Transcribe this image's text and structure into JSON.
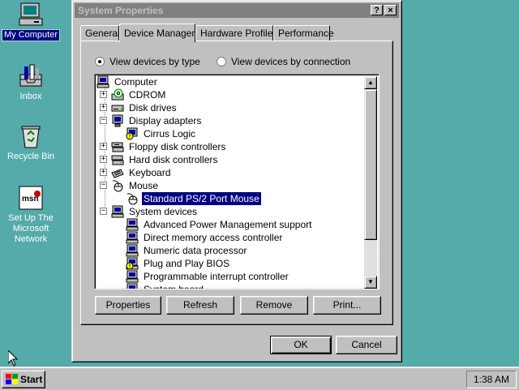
{
  "desktop": {
    "icons": [
      {
        "label": "My Computer",
        "icon": "my-computer-icon",
        "selected": true
      },
      {
        "label": "Inbox",
        "icon": "inbox-icon"
      },
      {
        "label": "Recycle Bin",
        "icon": "recycle-bin-icon"
      },
      {
        "label": "Set Up The Microsoft Network",
        "icon": "msn-icon"
      }
    ]
  },
  "dialog": {
    "title": "System Properties",
    "help_button": "?",
    "close_button": "×",
    "tabs": [
      {
        "label": "General"
      },
      {
        "label": "Device Manager",
        "active": true
      },
      {
        "label": "Hardware Profiles"
      },
      {
        "label": "Performance"
      }
    ],
    "view_options": {
      "by_type": "View devices by type",
      "by_connection": "View devices by connection",
      "selected": "by_type"
    },
    "tree": [
      {
        "label": "Computer",
        "level": 0,
        "icon": "computer-icon"
      },
      {
        "label": "CDROM",
        "level": 1,
        "expander": "+",
        "icon": "cdrom-icon"
      },
      {
        "label": "Disk drives",
        "level": 1,
        "expander": "+",
        "icon": "disk-drive-icon"
      },
      {
        "label": "Display adapters",
        "level": 1,
        "expander": "-",
        "icon": "monitor-icon"
      },
      {
        "label": "Cirrus Logic",
        "level": 2,
        "icon": "monitor-warning-icon"
      },
      {
        "label": "Floppy disk controllers",
        "level": 1,
        "expander": "+",
        "icon": "floppy-controller-icon"
      },
      {
        "label": "Hard disk controllers",
        "level": 1,
        "expander": "+",
        "icon": "hard-disk-controller-icon"
      },
      {
        "label": "Keyboard",
        "level": 1,
        "expander": "+",
        "icon": "keyboard-icon"
      },
      {
        "label": "Mouse",
        "level": 1,
        "expander": "-",
        "icon": "mouse-icon"
      },
      {
        "label": "Standard PS/2 Port Mouse",
        "level": 2,
        "icon": "mouse-icon",
        "selected": true
      },
      {
        "label": "System devices",
        "level": 1,
        "expander": "-",
        "icon": "system-device-icon"
      },
      {
        "label": "Advanced Power Management support",
        "level": 2,
        "icon": "system-device-icon"
      },
      {
        "label": "Direct memory access controller",
        "level": 2,
        "icon": "system-device-icon"
      },
      {
        "label": "Numeric data processor",
        "level": 2,
        "icon": "system-device-icon"
      },
      {
        "label": "Plug and Play BIOS",
        "level": 2,
        "icon": "system-device-warning-icon"
      },
      {
        "label": "Programmable interrupt controller",
        "level": 2,
        "icon": "system-device-icon"
      },
      {
        "label": "System board",
        "level": 2,
        "icon": "system-device-icon"
      }
    ],
    "actions": {
      "properties": "Properties",
      "refresh": "Refresh",
      "remove": "Remove",
      "print": "Print..."
    },
    "ok": "OK",
    "cancel": "Cancel"
  },
  "taskbar": {
    "start": "Start",
    "clock": "1:38 AM"
  }
}
